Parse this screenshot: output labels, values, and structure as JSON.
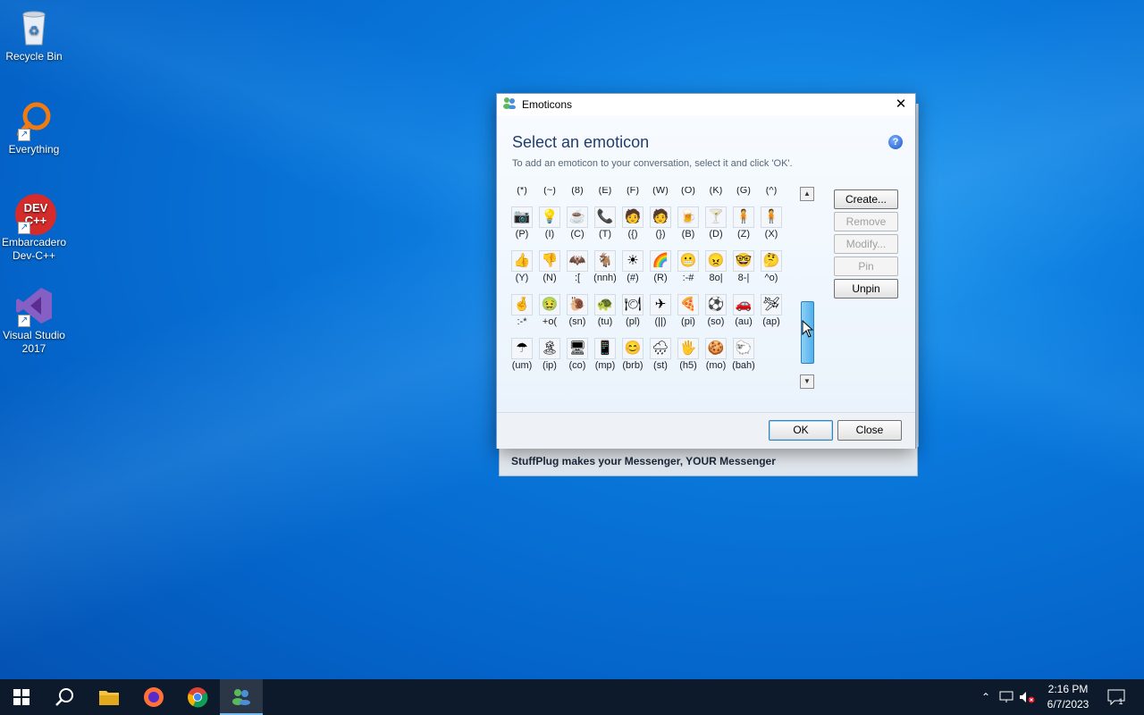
{
  "desktop": {
    "icons": [
      {
        "label": "Recycle Bin",
        "icon": "recycle-bin-icon"
      },
      {
        "label": "Everything",
        "icon": "everything-search-icon"
      },
      {
        "label": "Embarcadero Dev-C++",
        "icon": "devcpp-icon",
        "badge": "DEV C++"
      },
      {
        "label": "Visual Studio 2017",
        "icon": "visual-studio-icon"
      }
    ]
  },
  "window": {
    "title": "Emoticons",
    "close_glyph": "✕",
    "heading": "Select an emoticon",
    "subtext": "To add an emoticon to your conversation, select it and click 'OK'.",
    "help_glyph": "?",
    "rows": [
      {
        "codes": [
          "(*)",
          "(~)",
          "(8)",
          "(E)",
          "(F)",
          "(W)",
          "(O)",
          "(K)",
          "(G)",
          "(^)"
        ],
        "emojis": [
          "📷",
          "💡",
          "☕",
          "📞",
          "🧑",
          "🧑",
          "🍺",
          "🍸",
          "🧍",
          "🧍"
        ]
      },
      {
        "codes": [
          "(P)",
          "(I)",
          "(C)",
          "(T)",
          "({)",
          "(})",
          "(B)",
          "(D)",
          "(Z)",
          "(X)"
        ],
        "emojis": [
          "👍",
          "👎",
          "🦇",
          "🐐",
          "☀",
          "🌈",
          "😬",
          "😠",
          "🤓",
          "🤔"
        ]
      },
      {
        "codes": [
          "(Y)",
          "(N)",
          ":[",
          "(nnh)",
          "(#)",
          "(R)",
          ":-#",
          "8o|",
          "8-|",
          "^o)"
        ],
        "emojis": [
          "🤞",
          "🤢",
          "🐌",
          "🐢",
          "🍽",
          "✈",
          "🍕",
          "⚽",
          "🚗",
          "🛩"
        ]
      },
      {
        "codes": [
          ":-*",
          "+o(",
          "(sn)",
          "(tu)",
          "(pl)",
          "(||)",
          "(pi)",
          "(so)",
          "(au)",
          "(ap)"
        ],
        "emojis": [
          "☂",
          "🏝",
          "🖥",
          "📱",
          "😊",
          "🌧",
          "🖐",
          "🍪",
          "🐑"
        ]
      },
      {
        "codes": [
          "(um)",
          "(ip)",
          "(co)",
          "(mp)",
          "(brb)",
          "(st)",
          "(h5)",
          "(mo)",
          "(bah)"
        ],
        "emojis": []
      }
    ],
    "side_buttons": [
      {
        "label": "Create...",
        "enabled": true
      },
      {
        "label": "Remove",
        "enabled": false
      },
      {
        "label": "Modify...",
        "enabled": false
      },
      {
        "label": "Pin",
        "enabled": false
      },
      {
        "label": "Unpin",
        "enabled": true
      }
    ],
    "ok_label": "OK",
    "close_label": "Close",
    "scrollbar_position": 0.6
  },
  "banner": {
    "text": "StuffPlug makes your Messenger, YOUR Messenger"
  },
  "taskbar": {
    "items": [
      "windows-start-icon",
      "search-icon",
      "file-explorer-icon",
      "firefox-icon",
      "chrome-icon",
      "messenger-icon"
    ],
    "clock_time": "2:16 PM",
    "clock_date": "6/7/2023",
    "notification_count": "1"
  }
}
